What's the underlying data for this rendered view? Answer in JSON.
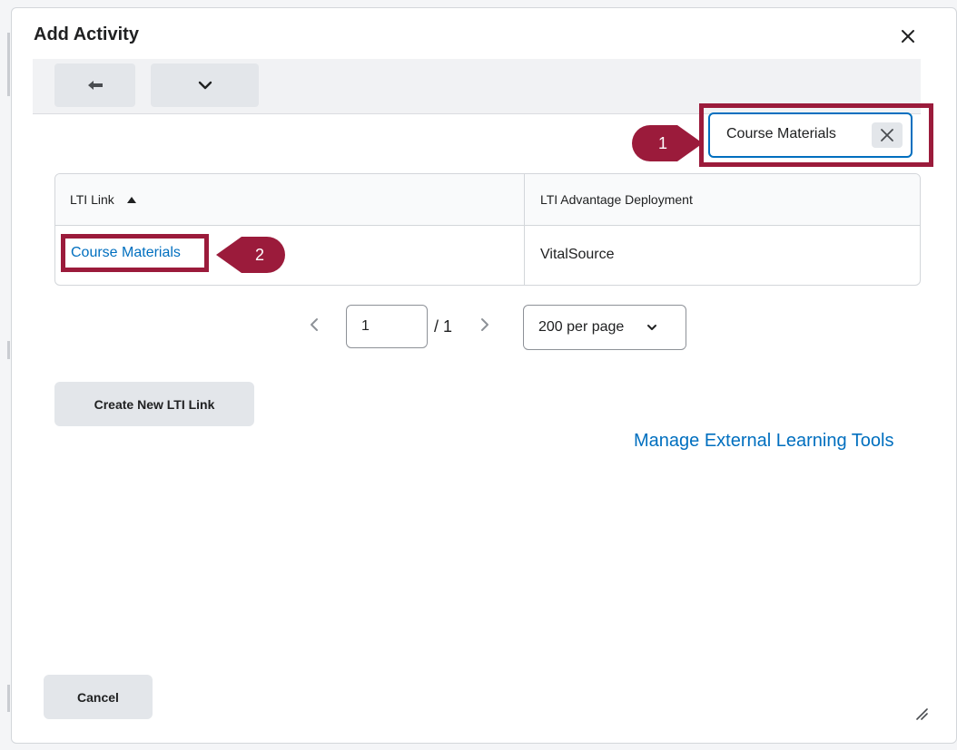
{
  "dialog": {
    "title": "Add Activity",
    "close_icon": "close-icon"
  },
  "toolbar": {
    "back_icon": "arrow-left-icon",
    "menu_icon": "chevron-down-icon"
  },
  "search": {
    "value": "Course Materials",
    "clear_icon": "close-icon"
  },
  "callouts": {
    "first": "1",
    "second": "2"
  },
  "table": {
    "columns": [
      "LTI Link",
      "LTI Advantage Deployment"
    ],
    "sort_icon": "sort-ascending-icon",
    "rows": [
      {
        "link": "Course Materials",
        "deployment": "VitalSource"
      }
    ]
  },
  "pagination": {
    "current_page": "1",
    "total": "/ 1",
    "per_page": "200 per page"
  },
  "actions": {
    "create_label": "Create New LTI Link",
    "manage_label": "Manage External Learning Tools",
    "cancel_label": "Cancel"
  },
  "colors": {
    "accent_link": "#006fbf",
    "highlight": "#9b1b3b",
    "button_bg": "#e3e6ea"
  }
}
